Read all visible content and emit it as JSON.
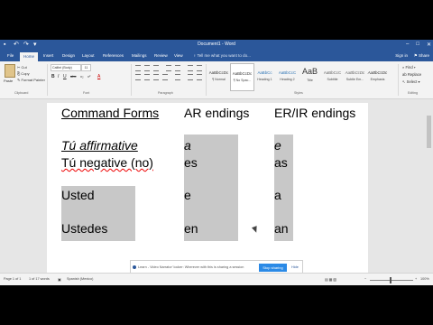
{
  "window": {
    "title": "Document1 - Word",
    "controls": [
      "–",
      "□",
      "✕"
    ]
  },
  "quick_access": {
    "icons": [
      "save-icon",
      "undo-icon",
      "redo-icon",
      "customize-icon"
    ],
    "save": "▪",
    "undo": "↶",
    "redo": "↷",
    "more": "▾"
  },
  "tabs": {
    "file": "File",
    "home": "Home",
    "insert": "Insert",
    "design": "Design",
    "layout": "Layout",
    "references": "References",
    "mailings": "Mailings",
    "review": "Review",
    "view": "View",
    "tell_me": "♀ Tell me what you want to do...",
    "sign_in": "Sign in",
    "share": "⚑ Share"
  },
  "ribbon": {
    "clipboard": {
      "paste": "Paste",
      "cut": "✂ Cut",
      "copy": "⎘ Copy",
      "format_painter": "✎ Format Painter",
      "group": "Clipboard"
    },
    "font": {
      "name": "Calibri (Body)",
      "size": "11",
      "bold": "B",
      "italic": "I",
      "underline": "U",
      "strike": "abc",
      "sub": "x₂",
      "sup": "x²",
      "color": "A",
      "group": "Font"
    },
    "paragraph": {
      "group": "Paragraph"
    },
    "styles": {
      "items": [
        {
          "sample": "AaBbCcDc",
          "name": "¶ Normal"
        },
        {
          "sample": "AaBbCcDc",
          "name": "¶ No Spac..."
        },
        {
          "sample": "AaBbCc",
          "name": "Heading 1"
        },
        {
          "sample": "AaBbCcC",
          "name": "Heading 2"
        },
        {
          "sample": "AaB",
          "name": "Title"
        },
        {
          "sample": "AaBbCcC",
          "name": "Subtitle"
        },
        {
          "sample": "AaBbCcDc",
          "name": "Subtle Em..."
        },
        {
          "sample": "AaBbCcDc",
          "name": "Emphasis"
        }
      ],
      "group": "Styles"
    },
    "editing": {
      "find": "⌕ Find ▾",
      "replace": "ab Replace",
      "select": "↖ Select ▾",
      "group": "Editing"
    }
  },
  "document": {
    "header": {
      "col1": "Command Forms",
      "col2": "AR endings",
      "col3": "ER/IR endings"
    },
    "rows": [
      {
        "label": "Tú affirmative",
        "ar": "a",
        "er": "e"
      },
      {
        "label": "Tú negative (no)",
        "ar": "es",
        "er": "as"
      },
      {
        "label": "Usted",
        "ar": "e",
        "er": "a"
      },
      {
        "label": "Ustedes",
        "ar": "en",
        "er": "an"
      }
    ]
  },
  "notification": {
    "text": "Learn - Video Narrator' locker: Wherever with this is sharing a session",
    "button": "Stop sharing",
    "hide": "Hide"
  },
  "status": {
    "page": "Page 1 of 1",
    "words": "1 of 17 words",
    "proof": "▣",
    "language": "Spanish (Mexico)",
    "zoom": "100%",
    "view_icons": "▤ ▦ ▧",
    "zoom_minus": "−",
    "zoom_plus": "+"
  }
}
